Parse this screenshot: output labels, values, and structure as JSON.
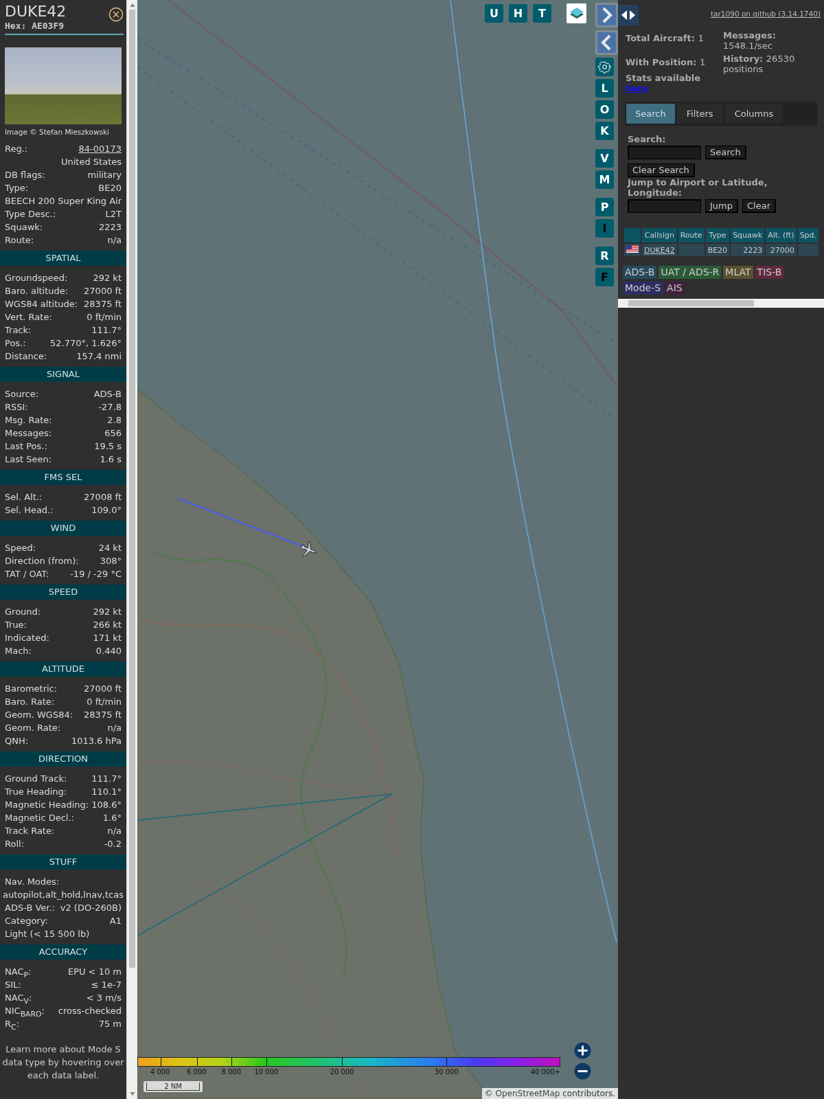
{
  "sidebar": {
    "callsign": "DUKE42",
    "hex": "Hex: AE03F9",
    "photo_credit": "Image © Stefan Mieszkowski",
    "info_rows": [
      {
        "kind": "link",
        "label": "Reg.:",
        "value": "84-00173"
      },
      {
        "kind": "right",
        "value": "United States"
      },
      {
        "kind": "pair",
        "label": "DB flags:",
        "value": "military"
      },
      {
        "kind": "pair",
        "label": "Type:",
        "value": "BE20"
      },
      {
        "kind": "center",
        "value": "BEECH 200 Super King Air"
      },
      {
        "kind": "pair",
        "label": "Type Desc.:",
        "value": "L2T"
      },
      {
        "kind": "pair",
        "label": "Squawk:",
        "value": "2223"
      },
      {
        "kind": "pair",
        "label": "Route:",
        "value": "n/a"
      }
    ],
    "sections": [
      {
        "title": "SPATIAL",
        "rows": [
          {
            "kind": "pair",
            "label": "Groundspeed:",
            "value": "292 kt"
          },
          {
            "kind": "pair",
            "label": "Baro. altitude:",
            "value": "27000 ft"
          },
          {
            "kind": "pair",
            "label": "WGS84 altitude:",
            "value": "28375 ft"
          },
          {
            "kind": "pair",
            "label": "Vert. Rate:",
            "value": "0 ft/min"
          },
          {
            "kind": "pair",
            "label": "Track:",
            "value": "111.7°"
          },
          {
            "kind": "pair",
            "label": "Pos.:",
            "value": "52.770°, 1.626°"
          },
          {
            "kind": "pair",
            "label": "Distance:",
            "value": "157.4 nmi"
          }
        ]
      },
      {
        "title": "SIGNAL",
        "rows": [
          {
            "kind": "pair",
            "label": "Source:",
            "value": "ADS-B"
          },
          {
            "kind": "pair",
            "label": "RSSI:",
            "value": "-27.8"
          },
          {
            "kind": "pair",
            "label": "Msg. Rate:",
            "value": "2.8"
          },
          {
            "kind": "pair",
            "label": "Messages:",
            "value": "656"
          },
          {
            "kind": "pair",
            "label": "Last Pos.:",
            "value": "19.5 s"
          },
          {
            "kind": "pair",
            "label": "Last Seen:",
            "value": "1.6 s"
          }
        ]
      },
      {
        "title": "FMS SEL",
        "rows": [
          {
            "kind": "pair",
            "label": "Sel. Alt.:",
            "value": "27008 ft"
          },
          {
            "kind": "pair",
            "label": "Sel. Head.:",
            "value": "109.0°"
          }
        ]
      },
      {
        "title": "WIND",
        "rows": [
          {
            "kind": "pair",
            "label": "Speed:",
            "value": "24 kt"
          },
          {
            "kind": "pair",
            "label": "Direction (from):",
            "value": "308°"
          },
          {
            "kind": "pair",
            "label": "TAT / OAT:",
            "value": "-19 / -29 °C"
          }
        ]
      },
      {
        "title": "SPEED",
        "rows": [
          {
            "kind": "pair",
            "label": "Ground:",
            "value": "292 kt"
          },
          {
            "kind": "pair",
            "label": "True:",
            "value": "266 kt"
          },
          {
            "kind": "pair",
            "label": "Indicated:",
            "value": "171 kt"
          },
          {
            "kind": "pair",
            "label": "Mach:",
            "value": "0.440"
          }
        ]
      },
      {
        "title": "ALTITUDE",
        "rows": [
          {
            "kind": "pair",
            "label": "Barometric:",
            "value": "27000 ft"
          },
          {
            "kind": "pair",
            "label": "Baro. Rate:",
            "value": "0 ft/min"
          },
          {
            "kind": "pair",
            "label": "Geom. WGS84:",
            "value": "28375 ft"
          },
          {
            "kind": "pair",
            "label": "Geom. Rate:",
            "value": "n/a"
          },
          {
            "kind": "pair",
            "label": "QNH:",
            "value": "1013.6 hPa"
          }
        ]
      },
      {
        "title": "DIRECTION",
        "rows": [
          {
            "kind": "pair",
            "label": "Ground Track:",
            "value": "111.7°"
          },
          {
            "kind": "pair",
            "label": "True Heading:",
            "value": "110.1°"
          },
          {
            "kind": "pair",
            "label": "Magnetic Heading:",
            "value": "108.6°"
          },
          {
            "kind": "pair",
            "label": "Magnetic Decl.:",
            "value": "1.6°"
          },
          {
            "kind": "pair",
            "label": "Track Rate:",
            "value": "n/a"
          },
          {
            "kind": "pair",
            "label": "Roll:",
            "value": "-0.2"
          }
        ]
      },
      {
        "title": "STUFF",
        "rows": [
          {
            "kind": "left",
            "value": "Nav. Modes:"
          },
          {
            "kind": "center",
            "value": "autopilot,alt_hold,lnav,tcas"
          },
          {
            "kind": "pair",
            "label": "ADS-B Ver.:",
            "value": "v2 (DO-260B)"
          },
          {
            "kind": "pair",
            "label": "Category:",
            "value": "A1"
          },
          {
            "kind": "left",
            "value": "Light (< 15 500 lb)"
          }
        ]
      },
      {
        "title": "ACCURACY",
        "rows": [
          {
            "kind": "pair",
            "label": "NAC$_{P}$:",
            "value": "EPU < 10 m"
          },
          {
            "kind": "pair",
            "label": "SIL:",
            "value": "≤ 1e-7"
          },
          {
            "kind": "pair",
            "label": "NAC$_{V}$:",
            "value": "< 3 m/s"
          },
          {
            "kind": "pair",
            "label": "NIC$_{BARO}$:",
            "value": "cross-checked"
          },
          {
            "kind": "pair",
            "label": "R$_{C}$:",
            "value": "75 m"
          }
        ]
      }
    ],
    "footer": "Learn more about Mode S data type by hovering over each data label."
  },
  "map": {
    "top_buttons": [
      "U",
      "H",
      "T"
    ],
    "side_button_groups": [
      [
        {
          "kind": "arrow_right"
        },
        {
          "kind": "arrow_left"
        },
        {
          "kind": "settings"
        },
        {
          "kind": "letter",
          "label": "L",
          "on": true
        },
        {
          "kind": "letter",
          "label": "O",
          "on": true
        },
        {
          "kind": "letter",
          "label": "K",
          "on": true
        }
      ],
      [
        {
          "kind": "letter",
          "label": "V",
          "on": true
        },
        {
          "kind": "letter",
          "label": "M",
          "on": true
        }
      ],
      [
        {
          "kind": "letter",
          "label": "P",
          "on": true
        },
        {
          "kind": "letter",
          "label": "I",
          "on": false
        }
      ],
      [
        {
          "kind": "letter",
          "label": "R",
          "on": true
        },
        {
          "kind": "letter",
          "label": "F",
          "on": false
        }
      ]
    ],
    "legend_ticks": [
      "4 000",
      "6 000",
      "8 000",
      "10 000",
      "20 000",
      "30 000",
      "40 000+"
    ],
    "scale": "2 NM",
    "attribution_link": "OpenStreetMap",
    "attribution_prefix": "©",
    "attribution_suffix": "contributors."
  },
  "right_panel": {
    "github_link": "tar1090 on github (3.14.1740)",
    "stats_left": [
      {
        "label": "Total Aircraft:",
        "value": "1"
      },
      {
        "label": "With Position:",
        "value": "1"
      }
    ],
    "stats_right": [
      {
        "label": "Messages:",
        "value": "1548.1/sec"
      },
      {
        "label": "History:",
        "value": "26530 positions"
      }
    ],
    "stats_note": "Stats available",
    "stats_link": "here",
    "tabs": [
      {
        "label": "Search",
        "selected": true
      },
      {
        "label": "Filters",
        "selected": false
      },
      {
        "label": "Columns",
        "selected": false
      }
    ],
    "search_label": "Search:",
    "search_button": "Search",
    "clear_search_button": "Clear Search",
    "jump_label": "Jump to Airport or Latitude, Longitude:",
    "jump_button": "Jump",
    "clear_button": "Clear",
    "table": {
      "columns": [
        "Callsign",
        "Route",
        "Type",
        "Squawk",
        "Alt. (ft)",
        "Spd."
      ],
      "rows": [
        {
          "callsign": "DUKE42",
          "route": "",
          "type": "BE20",
          "squawk": "2223",
          "altitude": "27000",
          "speed": ""
        }
      ]
    },
    "sources": [
      {
        "label": "ADS-B",
        "color": "#27495a"
      },
      {
        "label": "UAT / ADS-R",
        "color": "#2a5b38"
      },
      {
        "label": "MLAT",
        "color": "#5b5231"
      },
      {
        "label": "TIS-B",
        "color": "#5e2a3c"
      },
      {
        "label": "Mode-S",
        "color": "#2d2d63"
      },
      {
        "label": "AIS",
        "color": "#3f2140"
      }
    ]
  }
}
